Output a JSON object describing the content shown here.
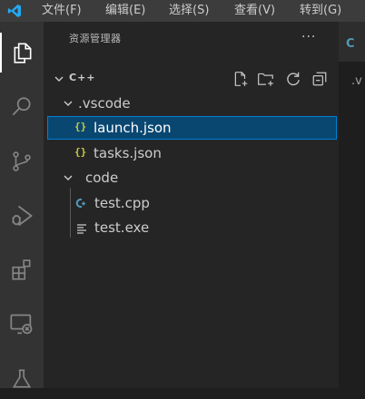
{
  "menu": {
    "items": [
      "文件(F)",
      "编辑(E)",
      "选择(S)",
      "查看(V)",
      "转到(G)"
    ]
  },
  "activity_bar": {
    "icons": [
      "explorer-icon",
      "search-icon",
      "source-control-icon",
      "run-debug-icon",
      "extensions-icon",
      "remote-explorer-icon",
      "testing-icon"
    ]
  },
  "explorer": {
    "title": "资源管理器",
    "more": "···",
    "folder_name": "C++",
    "actions": [
      "new-file-icon",
      "new-folder-icon",
      "refresh-icon",
      "collapse-all-icon"
    ],
    "tree": {
      "vscode_folder": ".vscode",
      "launch_icon": "{}",
      "launch_file": "launch.json",
      "tasks_icon": "{}",
      "tasks_file": "tasks.json",
      "code_folder": "code",
      "test_cpp": "test.cpp",
      "test_exe": "test.exe"
    }
  },
  "editor": {
    "tab_glyph": "C",
    "breadcrumb": ".v"
  },
  "colors": {
    "accent": "#007fd4",
    "selection": "#094771",
    "json_icon": "#cbcb41",
    "cpp_icon": "#519aba"
  }
}
